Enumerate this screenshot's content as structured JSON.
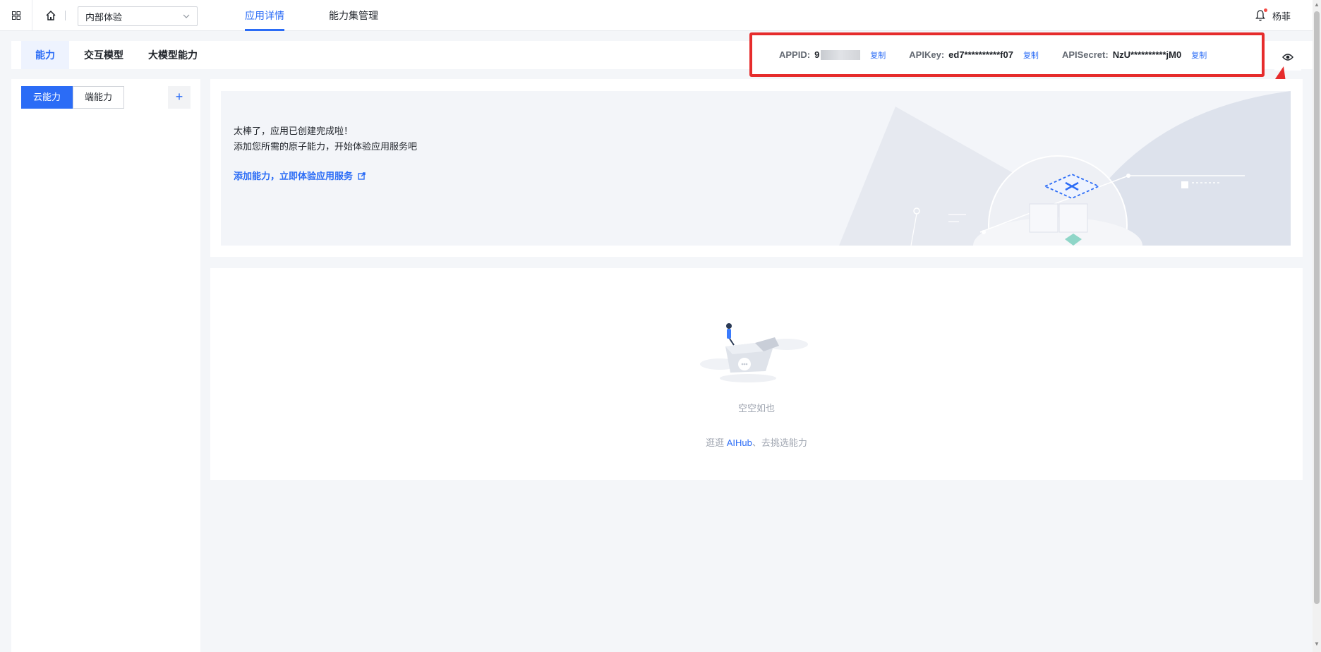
{
  "topbar": {
    "app_select_value": "内部体验",
    "tabs": [
      {
        "label": "应用详情",
        "active": true
      },
      {
        "label": "能力集管理",
        "active": false
      }
    ],
    "user_name": "杨菲"
  },
  "subheader": {
    "tabs": [
      {
        "label": "能力",
        "active": true
      },
      {
        "label": "交互模型",
        "active": false
      },
      {
        "label": "大模型能力",
        "active": false
      }
    ]
  },
  "credentials": {
    "appid_label": "APPID:",
    "appid_value": "9",
    "apikey_label": "APIKey:",
    "apikey_value": "ed7**********f07",
    "apisecret_label": "APISecret:",
    "apisecret_value": "NzU**********jM0",
    "copy_label": "复制"
  },
  "left_panel": {
    "segments": [
      {
        "label": "云能力",
        "active": true
      },
      {
        "label": "端能力",
        "active": false
      }
    ],
    "add_label": "+"
  },
  "banner": {
    "line1": "太棒了，应用已创建完成啦！",
    "line2": "添加您所需的原子能力，开始体验应用服务吧",
    "link": "添加能力，立即体验应用服务"
  },
  "empty_state": {
    "title": "空空如也",
    "sub_prefix": "逛逛",
    "sub_link": "AIHub",
    "sub_suffix": "、去挑选能力"
  },
  "colors": {
    "accent": "#2b6cf6",
    "highlight_box": "#e62c2c",
    "notification_dot": "#f54a45"
  },
  "icons": [
    "grid-icon",
    "home-icon",
    "chevron-down-icon",
    "bell-icon",
    "eye-icon",
    "external-link-icon"
  ]
}
